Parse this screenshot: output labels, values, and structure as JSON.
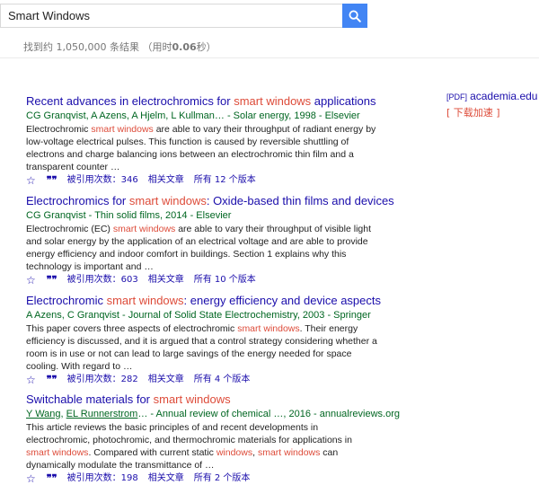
{
  "search": {
    "value": "Smart Windows"
  },
  "stats": {
    "prefix": "找到约 1,050,000 条结果 （用时",
    "time": "0.06",
    "suffix": "秒）"
  },
  "results": [
    {
      "title_pre": "Recent advances in electrochromics for ",
      "title_hl": "smart windows",
      "title_post": " applications",
      "meta": "CG Granqvist, A Azens, A Hjelm, L Kullman… - Solar energy, 1998 - Elsevier",
      "snippet_1": "Electrochromic ",
      "snippet_hl": "smart windows",
      "snippet_2": " are able to vary their throughput of radiant energy by low-voltage electrical pulses. This function is caused by reversible shuttling of electrons and charge balancing ions between an electrochromic thin film and a transparent counter …",
      "cited": "被引用次数：346",
      "related": "相关文章",
      "versions": "所有 12 个版本"
    },
    {
      "title_pre": "Electrochromics for ",
      "title_hl": "smart windows",
      "title_post": ": Oxide-based thin films and devices",
      "meta": "CG Granqvist - Thin solid films, 2014 - Elsevier",
      "snippet_1": "Electrochromic (EC) ",
      "snippet_hl": "smart windows",
      "snippet_2": " are able to vary their throughput of visible light and solar energy by the application of an electrical voltage and are able to provide energy efficiency and indoor comfort in buildings. Section 1 explains why this technology is important and …",
      "cited": "被引用次数：603",
      "related": "相关文章",
      "versions": "所有 10 个版本"
    },
    {
      "title_pre": "Electrochromic ",
      "title_hl": "smart windows",
      "title_post": ": energy efficiency and device aspects",
      "meta": "A Azens, C Granqvist - Journal of Solid State Electrochemistry, 2003 - Springer",
      "snippet_1": "This paper covers three aspects of electrochromic ",
      "snippet_hl": "smart windows",
      "snippet_2": ". Their energy efficiency is discussed, and it is argued that a control strategy considering whether a room is in use or not can lead to large savings of the energy needed for space cooling. With regard to …",
      "cited": "被引用次数：282",
      "related": "相关文章",
      "versions": "所有 4 个版本"
    },
    {
      "title_pre": "Switchable materials for ",
      "title_hl": "smart windows",
      "title_post": "",
      "meta_author1": "Y Wang",
      "meta_sep": ", ",
      "meta_author2": "EL Runnerstrom",
      "meta_rest": "… - Annual review of chemical …, 2016 - annualreviews.org",
      "snippet_1": "This article reviews the basic principles of and recent developments in electrochromic, photochromic, and thermochromic materials for applications in ",
      "snippet_hl": "smart windows",
      "snippet_2": ". Compared with current static ",
      "snippet_hl2": "windows",
      "snippet_3": ", ",
      "snippet_hl3": "smart windows",
      "snippet_4": " can dynamically modulate the transmittance of …",
      "cited": "被引用次数：198",
      "related": "相关文章",
      "versions": "所有 2 个版本"
    }
  ],
  "side": {
    "pdf_tag": "[PDF]",
    "domain": "academia.edu",
    "fast_download": "[ 下载加速 ]"
  },
  "icons": {
    "search": "search-icon",
    "star": "star-icon",
    "cite": "cite-icon"
  },
  "colors": {
    "search_button": "#4285f4",
    "title_link": "#1a0dab",
    "highlight": "#dd4b39",
    "meta": "#006621"
  }
}
